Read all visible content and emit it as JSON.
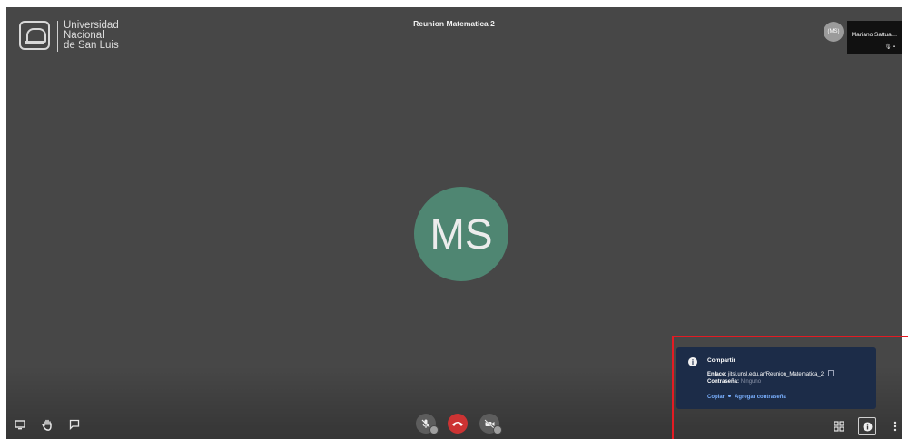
{
  "meeting": {
    "title": "Reunion Matematica 2"
  },
  "logo": {
    "line1": "Universidad",
    "line2": "Nacional",
    "line3": "de San Luis"
  },
  "participants": {
    "small_avatar_initials": "(MS)",
    "thumbnail_name": "Mariano Sattua…",
    "main_avatar_initials": "MS",
    "main_avatar_color": "#4f8672"
  },
  "toolbar": {
    "left": [
      "screen-share-icon",
      "raise-hand-icon",
      "chat-icon"
    ],
    "center": [
      "microphone-muted-icon",
      "hangup-icon",
      "camera-muted-icon"
    ],
    "right": [
      "tile-view-icon",
      "info-icon",
      "more-options-icon"
    ]
  },
  "share_popup": {
    "title": "Compartir",
    "link_label": "Enlace:",
    "link_value": "jitsi.unsl.edu.ar/Reunion_Matematica_2",
    "password_label": "Contraseña:",
    "password_value": "Ninguno",
    "copy_action": "Copiar",
    "add_password_action": "Agregar contraseña"
  },
  "colors": {
    "stage_bg": "#474747",
    "popup_bg": "#1c2c48",
    "hangup": "#cc3333",
    "link_action": "#7ab0ff",
    "highlight": "#e31b23"
  }
}
